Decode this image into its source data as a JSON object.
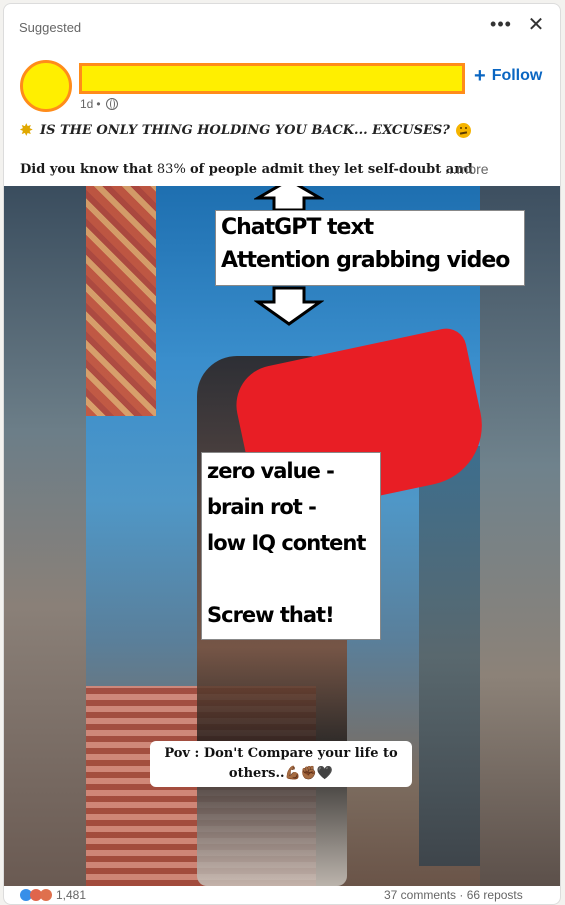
{
  "post": {
    "suggested_label": "Suggested",
    "menu_icon": "ellipsis-icon",
    "close_icon": "close-icon",
    "author": {
      "time": "1d",
      "separator": "•",
      "visibility_icon": "globe-icon"
    },
    "follow_label": "Follow",
    "headline": "IS THE ONLY THING HOLDING YOU BACK... EXCUSES?",
    "body_bold_prefix": "Did you know that",
    "body_number": "83%",
    "body_bold_suffix": "of people admit they let self-doubt and",
    "more_label": "...more"
  },
  "annotations": {
    "top_box": [
      "ChatGPT text",
      "Attention grabbing video"
    ],
    "middle_box": [
      "zero value -",
      "brain rot -",
      "low IQ content",
      "",
      "Screw that!"
    ]
  },
  "video": {
    "caption_line1": "Pov : Don't Compare your life to",
    "caption_line2": "others..",
    "caption_emojis": "💪🏾✊🏾🖤"
  },
  "footer": {
    "reaction_count": "1,481",
    "comments": "37 comments",
    "separator": "·",
    "reposts": "66 reposts"
  },
  "colors": {
    "accent": "#0a66c2",
    "redaction_fill": "#ffef00",
    "redaction_border": "#ff8c1a"
  }
}
